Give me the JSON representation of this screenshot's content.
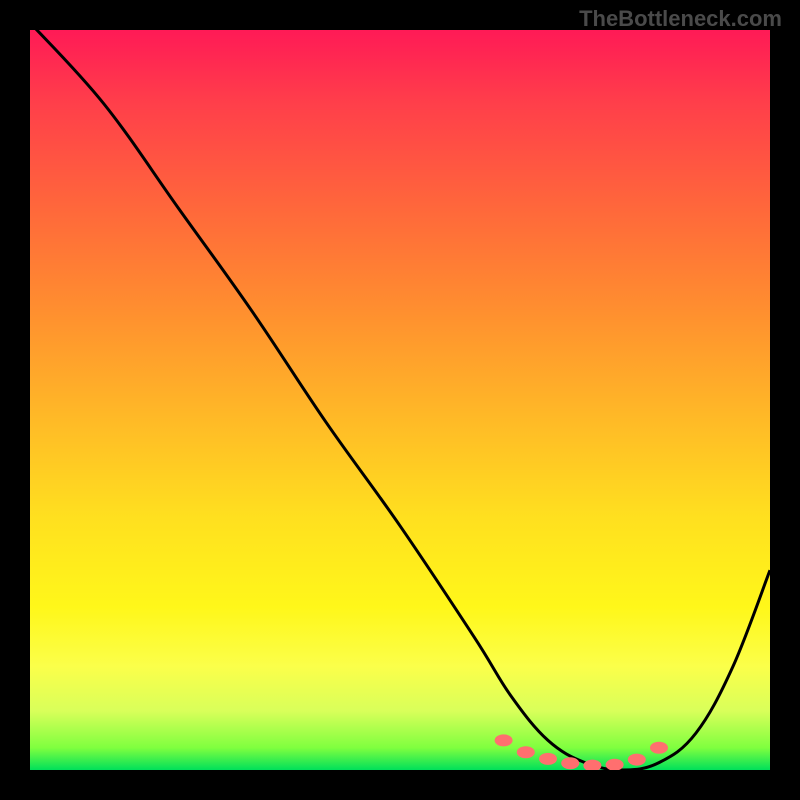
{
  "watermark": {
    "text": "TheBottleneck.com",
    "top": 6,
    "right": 18,
    "font_size": 22
  },
  "chart_data": {
    "type": "line",
    "title": "",
    "xlabel": "",
    "ylabel": "",
    "xlim": [
      0,
      100
    ],
    "ylim": [
      0,
      100
    ],
    "grid": false,
    "legend": false,
    "series": [
      {
        "name": "curve",
        "x": [
          0,
          10,
          20,
          30,
          40,
          50,
          60,
          65,
          70,
          75,
          80,
          85,
          90,
          95,
          100
        ],
        "values": [
          101,
          90,
          76,
          62,
          47,
          33,
          18,
          10,
          4,
          1,
          0,
          1,
          5,
          14,
          27
        ]
      }
    ],
    "markers": {
      "name": "flat-region-dots",
      "color": "#ff6f6f",
      "x": [
        64,
        67,
        70,
        73,
        76,
        79,
        82,
        85
      ],
      "values": [
        4.0,
        2.4,
        1.5,
        0.9,
        0.6,
        0.7,
        1.4,
        3.0
      ]
    },
    "gradient_theme": {
      "top": "#ff1a56",
      "mid1": "#ff8f2f",
      "mid2": "#ffe01f",
      "bottom": "#00e05a"
    }
  }
}
